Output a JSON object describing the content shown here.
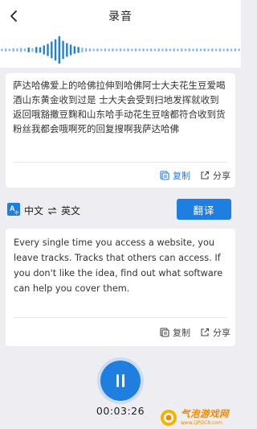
{
  "header": {
    "title": "录音",
    "back_icon": "chevron-left-icon"
  },
  "waveform": {
    "color": "#1e7fe0",
    "levels": [
      0.08,
      0.1,
      0.08,
      0.12,
      0.1,
      0.14,
      0.1,
      0.16,
      0.12,
      0.2,
      0.18,
      0.3,
      0.4,
      0.55,
      0.7,
      0.9,
      0.6,
      0.45,
      0.35,
      0.25,
      0.2,
      0.15,
      0.12,
      0.1,
      0.08,
      0.1,
      0.08,
      0.1,
      0.08,
      0.1,
      0.08,
      0.1,
      0.08,
      0.1,
      0.08,
      0.1,
      0.08,
      0.1,
      0.08,
      0.1,
      0.08,
      0.1,
      0.08,
      0.1,
      0.08,
      0.1,
      0.08,
      0.1,
      0.08,
      0.1,
      0.08,
      0.1,
      0.08,
      0.1,
      0.08,
      0.1,
      0.08,
      0.1,
      0.08,
      0.1,
      0.08,
      0.1,
      0.08
    ]
  },
  "source": {
    "text": "萨达哈佛爱上的哈佛拉伸到哈佛阿士大夫花生豆爱喝酒山东黄金收到过是  士大夫会受到扫地发挥就收到返回哦豁撒豆麴和山东哈手动花生豆啥都符合收到货粉丝我都会哦啊死的回复搜啊我萨达哈佛",
    "copy_label": "复制",
    "share_label": "分享"
  },
  "language": {
    "from": "中文",
    "swap_icon": "swap-arrows-icon",
    "to": "英文",
    "translate_label": "翻译"
  },
  "result": {
    "text": "Every single time you access a website, you leave tracks. Tracks that others can access. If you don't like the idea, find out what software can help you cover them.",
    "copy_label": "复制",
    "share_label": "分享"
  },
  "recorder": {
    "pause_icon": "pause-icon",
    "elapsed": "00:03:26"
  },
  "watermark": {
    "main": "气泡游戏网",
    "sub": "www.QPGC8.com"
  },
  "colors": {
    "accent": "#1e7fe0",
    "background": "#ededf2",
    "card": "#ffffff",
    "watermark": "#f08a00"
  }
}
